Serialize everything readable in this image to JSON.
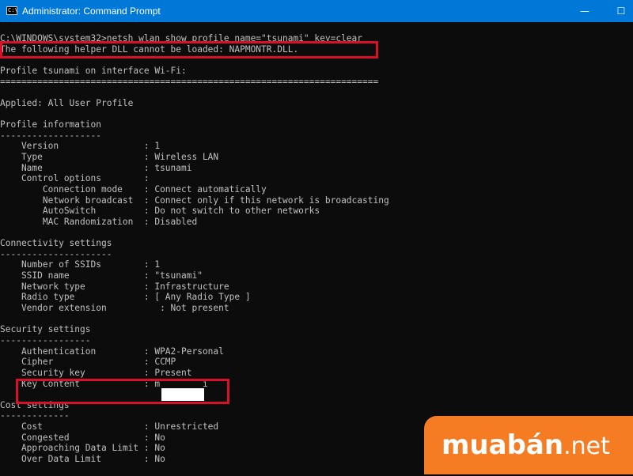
{
  "window": {
    "title": "Administrator: Command Prompt",
    "icon_label": "C:\\",
    "minimize_icon": "—",
    "maximize_icon": "☐"
  },
  "console": {
    "lines": [
      "C:\\WINDOWS\\system32>netsh wlan show profile name=\"tsunami\" key=clear",
      "The following helper DLL cannot be loaded: NAPMONTR.DLL.",
      "",
      "Profile tsunami on interface Wi-Fi:",
      "=======================================================================",
      "",
      "Applied: All User Profile",
      "",
      "Profile information",
      "-------------------",
      "    Version                : 1",
      "    Type                   : Wireless LAN",
      "    Name                   : tsunami",
      "    Control options        :",
      "        Connection mode    : Connect automatically",
      "        Network broadcast  : Connect only if this network is broadcasting",
      "        AutoSwitch         : Do not switch to other networks",
      "        MAC Randomization  : Disabled",
      "",
      "Connectivity settings",
      "---------------------",
      "    Number of SSIDs        : 1",
      "    SSID name              : \"tsunami\"",
      "    Network type           : Infrastructure",
      "    Radio type             : [ Any Radio Type ]",
      "    Vendor extension          : Not present",
      "",
      "Security settings",
      "-----------------",
      "    Authentication         : WPA2-Personal",
      "    Cipher                 : CCMP",
      "    Security key           : Present",
      "    Key Content            : m        i",
      "",
      "Cost settings",
      "-------------",
      "    Cost                   : Unrestricted",
      "    Congested              : No",
      "    Approaching Data Limit : No",
      "    Over Data Limit        : No"
    ]
  },
  "watermark": {
    "brand": "muabán",
    "suffix": ".net"
  },
  "colors": {
    "titlebar": "#0078d7",
    "console_background": "#0c0c0c",
    "console_text": "#c0c0c0",
    "highlight": "#d8102a",
    "watermark": "#f57c22"
  }
}
